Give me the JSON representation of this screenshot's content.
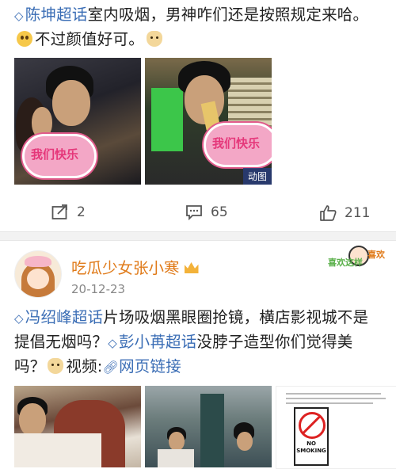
{
  "post1": {
    "topic": "陈坤超话",
    "text_line1": "室内吸烟，男神咋们还是按照规定来哈。",
    "text_line2": "不过颜值好可。",
    "emoji1": "smile-face-emoji",
    "emoji2": "doge-emoji",
    "images": [
      {
        "sticker_text": "我们快乐"
      },
      {
        "sticker_text": "我们快乐",
        "badge": "动图"
      }
    ],
    "actions": {
      "repost_count": "2",
      "comment_count": "65",
      "like_count": "211"
    }
  },
  "post2": {
    "username": "吃瓜少女张小寒",
    "time": "20-12-23",
    "deco_left": "喜欢这样",
    "deco_right": "喜欢",
    "topic1": "冯绍峰超话",
    "text1": "片场吸烟黑眼圈抢镜，横店影视城不是",
    "text2": "提倡无烟吗？",
    "topic2": "彭小苒超话",
    "text3": "没脖子造型你们觉得美",
    "text4": "吗？",
    "video_label": "视频:",
    "link_text": "网页链接",
    "sign_text1": "NO",
    "sign_text2": "SMOKING"
  },
  "colors": {
    "topic_blue": "#3a6db5",
    "username_orange": "#e07b1a",
    "action_gray": "#555555"
  }
}
